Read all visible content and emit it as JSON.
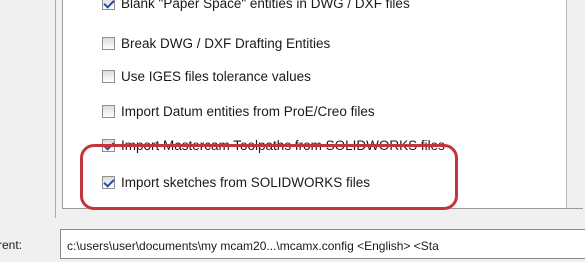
{
  "options": [
    {
      "label": "Blank \"Paper Space\" entities in DWG / DXF files",
      "checked": true
    },
    {
      "label": "Break DWG / DXF Drafting Entities",
      "checked": false
    },
    {
      "label": "Use IGES files tolerance values",
      "checked": false
    },
    {
      "label": "Import Datum entities from ProE/Creo files",
      "checked": false
    },
    {
      "label": "Import Mastercam Toolpaths from SOLIDWORKS files",
      "checked": true
    },
    {
      "label": "Import sketches from SOLIDWORKS files",
      "checked": true
    }
  ],
  "footer": {
    "label": "rent:",
    "path_value": "c:\\users\\user\\documents\\my mcam20...\\mcamx.config <English> <Sta"
  },
  "colors": {
    "highlight": "#c3343b",
    "checkmark": "#2050a8"
  }
}
